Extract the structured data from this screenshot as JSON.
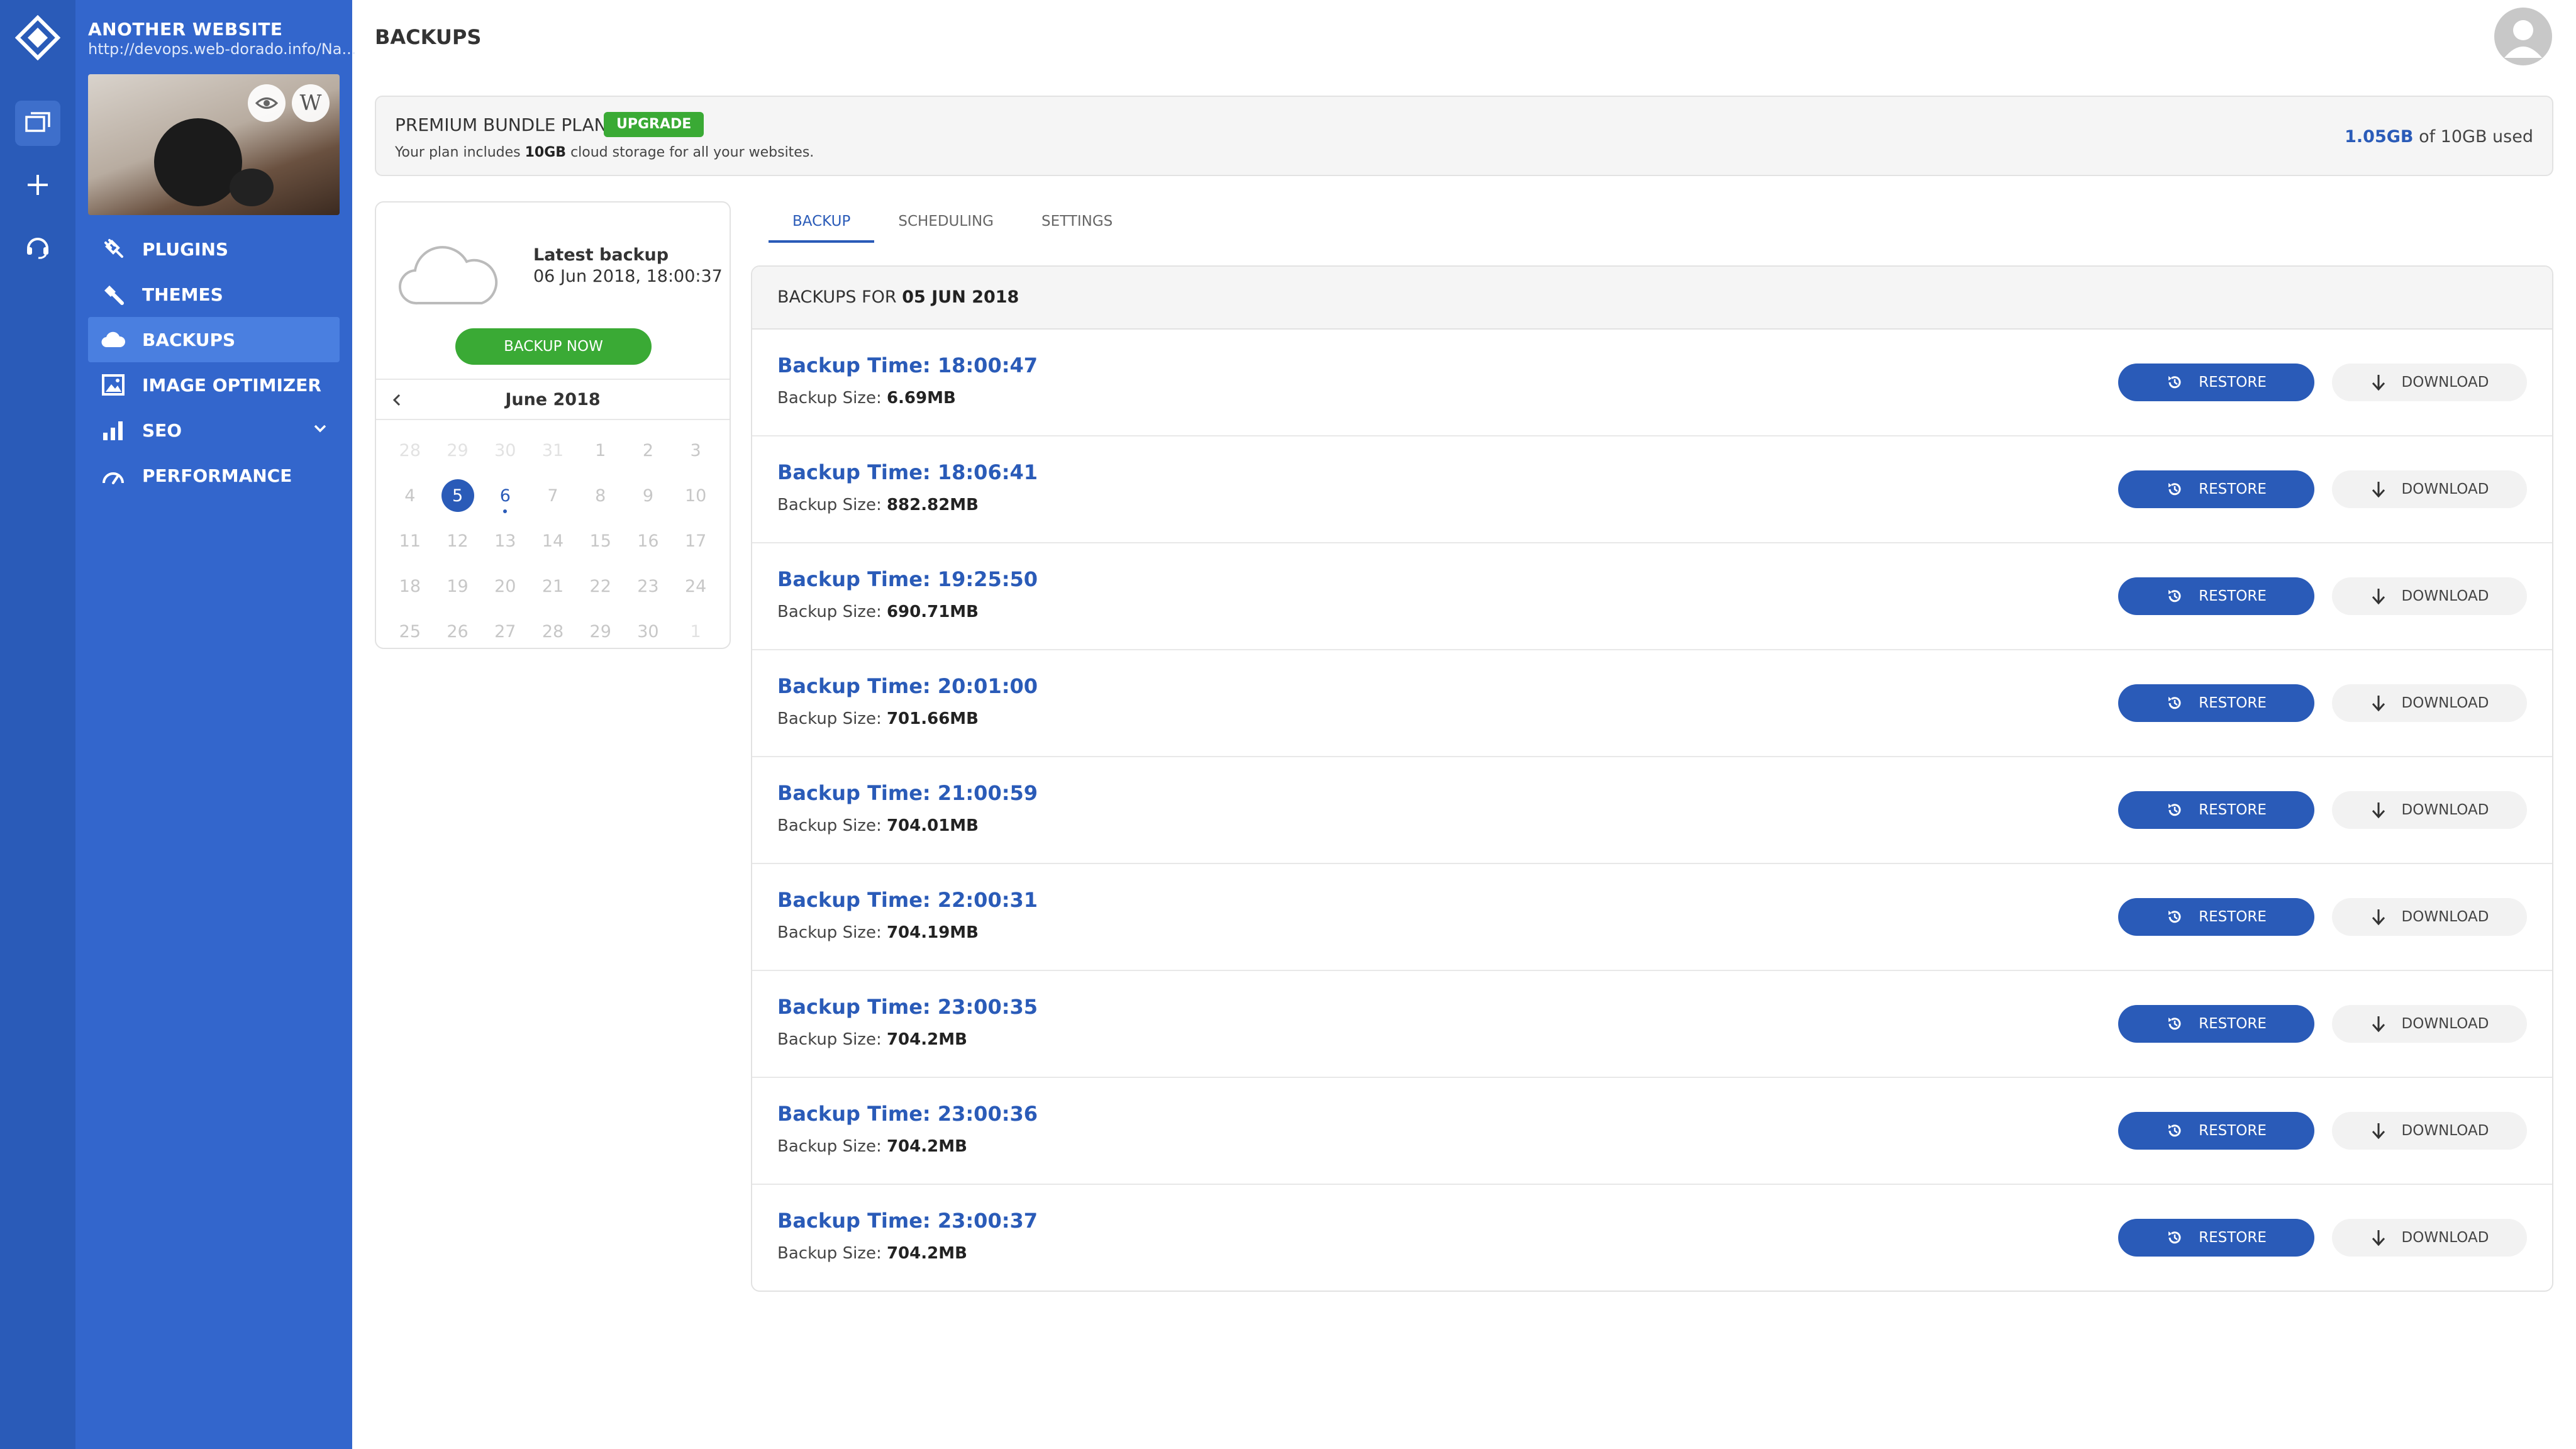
{
  "sidebar": {
    "site_title": "ANOTHER WEBSITE",
    "site_url": "http://devops.web-dorado.info/Na...",
    "thumbnail_icons": [
      "eye-icon",
      "wordpress-icon"
    ],
    "wordpress_glyph": "W",
    "items": [
      {
        "label": "PLUGINS",
        "icon": "plug-icon",
        "active": false
      },
      {
        "label": "THEMES",
        "icon": "brush-icon",
        "active": false
      },
      {
        "label": "BACKUPS",
        "icon": "cloud-icon",
        "active": true
      },
      {
        "label": "IMAGE OPTIMIZER",
        "icon": "image-icon",
        "active": false
      },
      {
        "label": "SEO",
        "icon": "bar-chart-icon",
        "active": false,
        "expandable": true
      },
      {
        "label": "PERFORMANCE",
        "icon": "gauge-icon",
        "active": false
      }
    ]
  },
  "rail": {
    "items": [
      "websites-icon",
      "plus-icon",
      "headset-icon"
    ],
    "active": "websites-icon"
  },
  "header": {
    "title": "BACKUPS"
  },
  "plan": {
    "name": "PREMIUM BUNDLE PLAN",
    "upgrade_label": "UPGRADE",
    "desc_prefix": "Your plan includes ",
    "desc_bold": "10GB",
    "desc_suffix": " cloud storage for all your websites.",
    "used": "1.05GB",
    "of_total": " of 10GB used"
  },
  "latest": {
    "label": "Latest backup",
    "date": "06 Jun 2018, 18:00:37",
    "backup_now_label": "BACKUP NOW"
  },
  "calendar": {
    "month": "June 2018",
    "days": [
      {
        "d": "28",
        "m": true
      },
      {
        "d": "29",
        "m": true
      },
      {
        "d": "30",
        "m": true
      },
      {
        "d": "31",
        "m": true
      },
      {
        "d": "1"
      },
      {
        "d": "2"
      },
      {
        "d": "3"
      },
      {
        "d": "4"
      },
      {
        "d": "5",
        "sel": true
      },
      {
        "d": "6",
        "has": true
      },
      {
        "d": "7"
      },
      {
        "d": "8"
      },
      {
        "d": "9"
      },
      {
        "d": "10"
      },
      {
        "d": "11"
      },
      {
        "d": "12"
      },
      {
        "d": "13"
      },
      {
        "d": "14"
      },
      {
        "d": "15"
      },
      {
        "d": "16"
      },
      {
        "d": "17"
      },
      {
        "d": "18"
      },
      {
        "d": "19"
      },
      {
        "d": "20"
      },
      {
        "d": "21"
      },
      {
        "d": "22"
      },
      {
        "d": "23"
      },
      {
        "d": "24"
      },
      {
        "d": "25"
      },
      {
        "d": "26"
      },
      {
        "d": "27"
      },
      {
        "d": "28"
      },
      {
        "d": "29"
      },
      {
        "d": "30"
      },
      {
        "d": "1",
        "m": true
      }
    ]
  },
  "tabs": [
    {
      "label": "BACKUP",
      "active": true
    },
    {
      "label": "SCHEDULING",
      "active": false
    },
    {
      "label": "SETTINGS",
      "active": false
    }
  ],
  "list": {
    "heading_prefix": "BACKUPS FOR ",
    "heading_date": "05 JUN 2018",
    "time_prefix": "Backup Time: ",
    "size_prefix": "Backup Size: ",
    "restore_label": "RESTORE",
    "download_label": "DOWNLOAD",
    "rows": [
      {
        "time": "18:00:47",
        "size": "6.69MB"
      },
      {
        "time": "18:06:41",
        "size": "882.82MB"
      },
      {
        "time": "19:25:50",
        "size": "690.71MB"
      },
      {
        "time": "20:01:00",
        "size": "701.66MB"
      },
      {
        "time": "21:00:59",
        "size": "704.01MB"
      },
      {
        "time": "22:00:31",
        "size": "704.19MB"
      },
      {
        "time": "23:00:35",
        "size": "704.2MB"
      },
      {
        "time": "23:00:36",
        "size": "704.2MB"
      },
      {
        "time": "23:00:37",
        "size": "704.2MB"
      }
    ]
  },
  "colors": {
    "brand": "#2a5bb8",
    "sidebar": "#3366cc",
    "rail": "#2a5bb8",
    "success": "#3aaa35"
  }
}
